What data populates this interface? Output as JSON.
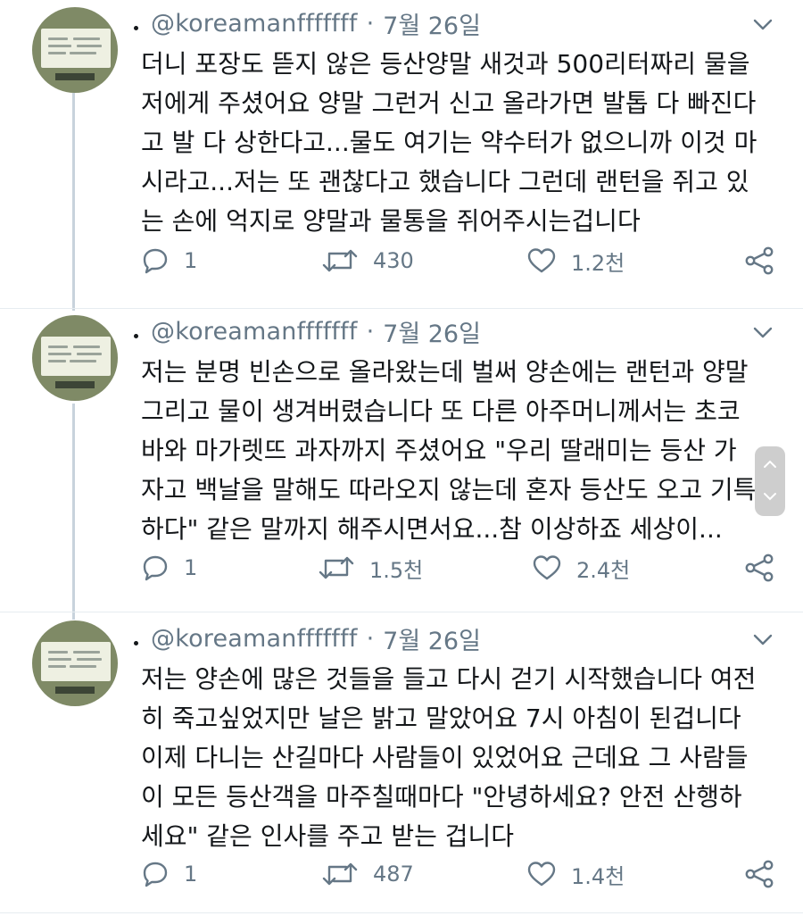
{
  "tweets": [
    {
      "handle": "@koreamanfffffff",
      "separator": "·",
      "date": "7월 26일",
      "text": "더니 포장도 뜯지 않은 등산양말 새것과 500리터짜리 물을\n저에게 주셨어요 양말 그런거 신고 올라가면 발톱 다 빠진다\n고 발 다 상한다고...물도 여기는 약수터가 없으니까 이것 마\n시라고...저는 또 괜찮다고 했습니다 그런데 랜턴을 쥐고 있\n는 손에 억지로 양말과 물통을 쥐어주시는겁니다",
      "replies": "1",
      "retweets": "430",
      "likes": "1.2천"
    },
    {
      "handle": "@koreamanfffffff",
      "separator": "·",
      "date": "7월 26일",
      "text": "저는 분명 빈손으로 올라왔는데 벌써 양손에는 랜턴과 양말\n그리고 물이 생겨버렸습니다 또 다른 아주머니께서는 초코\n바와 마가렛뜨 과자까지 주셨어요 \"우리 딸래미는 등산 가\n자고 백날을 말해도 따라오지 않는데 혼자 등산도 오고 기특\n하다\" 같은 말까지 해주시면서요...참 이상하죠 세상이...",
      "replies": "1",
      "retweets": "1.5천",
      "likes": "2.4천"
    },
    {
      "handle": "@koreamanfffffff",
      "separator": "·",
      "date": "7월 26일",
      "text": "저는 양손에 많은 것들을 들고 다시 걷기 시작했습니다 여전\n히 죽고싶었지만 날은 밝고 말았어요 7시 아침이 된겁니다\n이제 다니는 산길마다 사람들이 있었어요 근데요 그 사람들\n이 모든 등산객을 마주칠때마다 \"안녕하세요? 안전 산행하\n세요\" 같은 인사를 주고 받는 겁니다",
      "replies": "1",
      "retweets": "487",
      "likes": "1.4천"
    }
  ],
  "colors": {
    "text": "#14171a",
    "muted": "#657786",
    "thread_line": "#c8d3dc",
    "divider": "#e6ecf0"
  },
  "icons": [
    "reply-icon",
    "retweet-icon",
    "like-icon",
    "share-icon",
    "chevron-down-icon"
  ]
}
